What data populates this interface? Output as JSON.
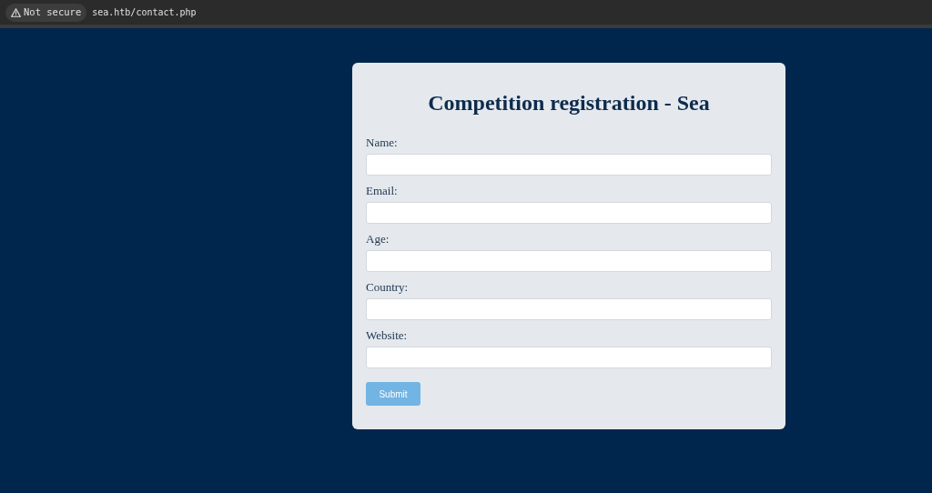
{
  "browser": {
    "security": "Not secure",
    "url": "sea.htb/contact.php"
  },
  "form": {
    "title": "Competition registration - Sea",
    "fields": [
      {
        "label": "Name:"
      },
      {
        "label": "Email:"
      },
      {
        "label": "Age:"
      },
      {
        "label": "Country:"
      },
      {
        "label": "Website:"
      }
    ],
    "submit": "Submit"
  }
}
